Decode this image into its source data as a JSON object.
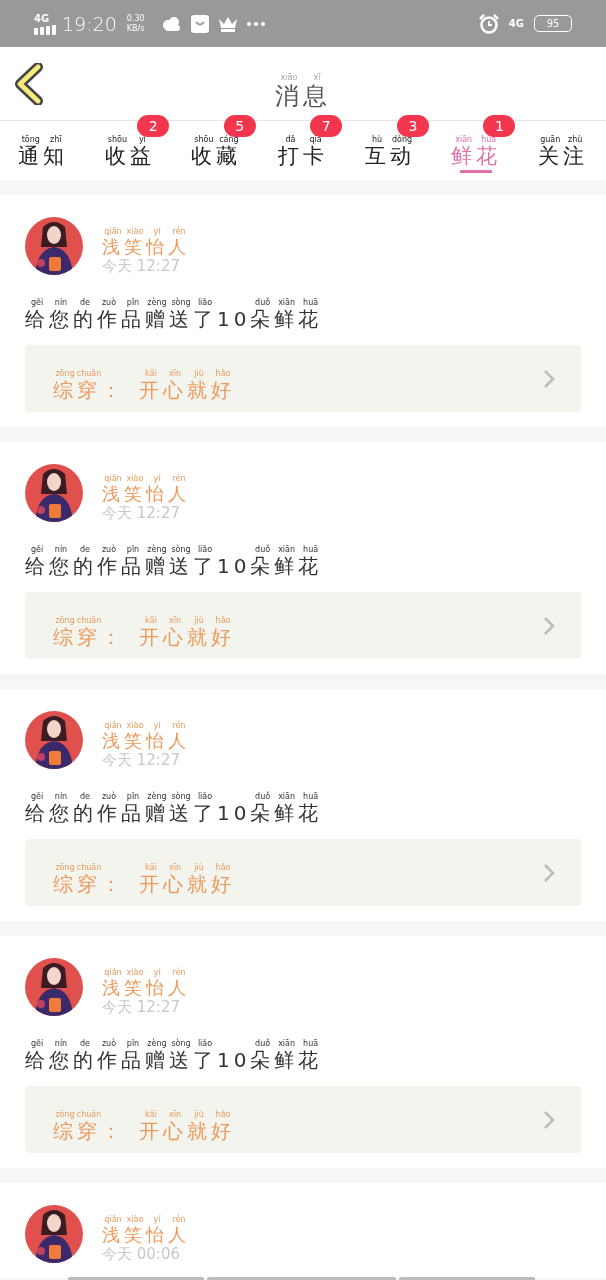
{
  "status_bar": {
    "network": "4G",
    "time": "19:20",
    "speed": "0.30",
    "speed_unit": "KB/s",
    "network_right": "4G",
    "battery": "95"
  },
  "header": {
    "title": {
      "text": "消息",
      "pinyin": "xiāo xī"
    }
  },
  "tabs": [
    {
      "text": "通知",
      "pinyin": "tōng zhī",
      "selected": false
    },
    {
      "text": "收益",
      "pinyin": "shōu yì",
      "badge": "2",
      "selected": false
    },
    {
      "text": "收藏",
      "pinyin": "shōu cáng",
      "badge": "5",
      "selected": false
    },
    {
      "text": "打卡",
      "pinyin": "dǎ qiǎ",
      "badge": "7",
      "selected": false
    },
    {
      "text": "互动",
      "pinyin": "hù dòng",
      "badge": "3",
      "selected": false
    },
    {
      "text": "鲜花",
      "pinyin": "xiān huā",
      "badge": "1",
      "selected": true
    },
    {
      "text": "关注",
      "pinyin": "guān zhù",
      "selected": false
    }
  ],
  "messages": [
    {
      "name": {
        "text": "浅笑怡人",
        "pinyin": "qiǎn xiào yí rén"
      },
      "day": "今天",
      "time": "12:27",
      "text": {
        "text": "给您的作品赠送了10朵鲜花",
        "pinyin": "gěi nín de zuò pǐn zèng sòng liǎo duǒ xiān huā"
      },
      "quote_label": {
        "text": "综穿：",
        "pinyin": "zōng chuān"
      },
      "quote": {
        "text": "开心就好",
        "pinyin": "kāi xīn jiù hǎo"
      }
    },
    {
      "name": {
        "text": "浅笑怡人",
        "pinyin": "qiǎn xiào yí rén"
      },
      "day": "今天",
      "time": "12:27",
      "text": {
        "text": "给您的作品赠送了10朵鲜花",
        "pinyin": "gěi nín de zuò pǐn zèng sòng liǎo duǒ xiān huā"
      },
      "quote_label": {
        "text": "综穿：",
        "pinyin": "zōng chuān"
      },
      "quote": {
        "text": "开心就好",
        "pinyin": "kāi xīn jiù hǎo"
      }
    },
    {
      "name": {
        "text": "浅笑怡人",
        "pinyin": "qiǎn xiào yí rén"
      },
      "day": "今天",
      "time": "12:27",
      "text": {
        "text": "给您的作品赠送了10朵鲜花",
        "pinyin": "gěi nín de zuò pǐn zèng sòng liǎo duǒ xiān huā"
      },
      "quote_label": {
        "text": "综穿：",
        "pinyin": "zōng chuān"
      },
      "quote": {
        "text": "开心就好",
        "pinyin": "kāi xīn jiù hǎo"
      }
    },
    {
      "name": {
        "text": "浅笑怡人",
        "pinyin": "qiǎn xiào yí rén"
      },
      "day": "今天",
      "time": "12:27",
      "text": {
        "text": "给您的作品赠送了10朵鲜花",
        "pinyin": "gěi nín de zuò pǐn zèng sòng liǎo duǒ xiān huā"
      },
      "quote_label": {
        "text": "综穿：",
        "pinyin": "zōng chuān"
      },
      "quote": {
        "text": "开心就好",
        "pinyin": "kāi xīn jiù hǎo"
      }
    },
    {
      "name": {
        "text": "浅笑怡人",
        "pinyin": "qiǎn xiào yí rén"
      },
      "day": "今天",
      "time": "00:06"
    }
  ]
}
